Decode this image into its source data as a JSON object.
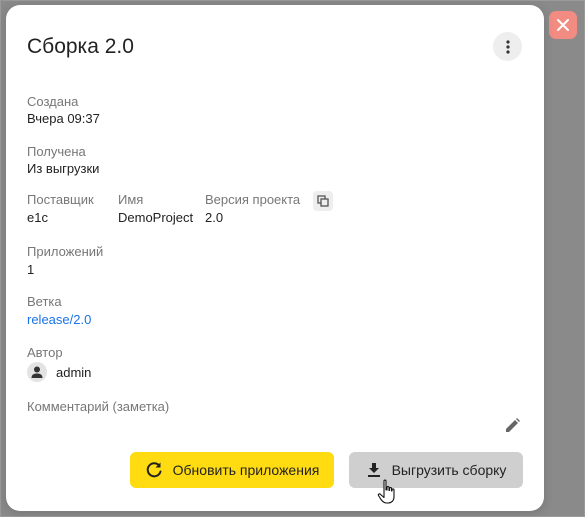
{
  "dialog": {
    "title": "Сборка 2.0",
    "fields": {
      "created": {
        "label": "Создана",
        "value": "Вчера 09:37"
      },
      "received": {
        "label": "Получена",
        "value": "Из выгрузки"
      },
      "vendor": {
        "label": "Поставщик",
        "value": "e1c"
      },
      "name": {
        "label": "Имя",
        "value": "DemoProject"
      },
      "project_version": {
        "label": "Версия проекта",
        "value": "2.0"
      },
      "apps": {
        "label": "Приложений",
        "value": "1"
      },
      "branch": {
        "label": "Ветка",
        "value": "release/2.0"
      },
      "author": {
        "label": "Автор",
        "value": "admin"
      },
      "comment": {
        "label": "Комментарий (заметка)",
        "value": ""
      }
    },
    "buttons": {
      "refresh": "Обновить приложения",
      "export": "Выгрузить сборку"
    }
  },
  "icons": {
    "close": "close-icon",
    "more": "more-vert-icon",
    "copy": "copy-icon",
    "avatar": "person-icon",
    "edit": "pencil-icon",
    "refresh": "refresh-icon",
    "download": "download-icon",
    "cursor": "hand-cursor-icon"
  },
  "colors": {
    "accent_yellow": "#ffdb11",
    "close_red": "#f28b82",
    "link_blue": "#1a73e8",
    "export_gray": "#cfcfcf"
  }
}
